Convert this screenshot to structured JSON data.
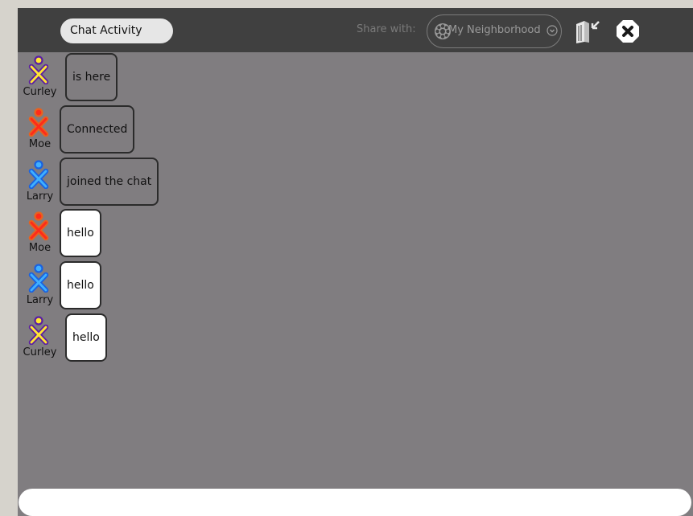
{
  "toolbar": {
    "activity_title": "Chat Activity",
    "share_label": "Share with:",
    "share_value": "My Neighborhood",
    "keep_icon": "keep-journal-icon",
    "stop_icon": "stop-icon"
  },
  "messages": [
    {
      "nick": "Curley",
      "text": "is here",
      "kind": "status",
      "xo_stroke": "#5b1fa3",
      "xo_fill": "#ffe633"
    },
    {
      "nick": "Moe",
      "text": "Connected",
      "kind": "status",
      "xo_stroke": "#e8621e",
      "xo_fill": "#ff2a1a"
    },
    {
      "nick": "Larry",
      "text": "joined the chat",
      "kind": "status",
      "xo_stroke": "#1a62e0",
      "xo_fill": "#3fb0ff"
    },
    {
      "nick": "Moe",
      "text": "hello",
      "kind": "text",
      "xo_stroke": "#e8621e",
      "xo_fill": "#ff2a1a"
    },
    {
      "nick": "Larry",
      "text": "hello",
      "kind": "text",
      "xo_stroke": "#1a62e0",
      "xo_fill": "#3fb0ff"
    },
    {
      "nick": "Curley",
      "text": "hello",
      "kind": "text",
      "xo_stroke": "#5b1fa3",
      "xo_fill": "#ffe633"
    }
  ],
  "entry": {
    "value": "",
    "placeholder": ""
  },
  "colors": {
    "canvas": "#807d80",
    "toolbar": "#404040",
    "frame": "#d6d3cc"
  }
}
